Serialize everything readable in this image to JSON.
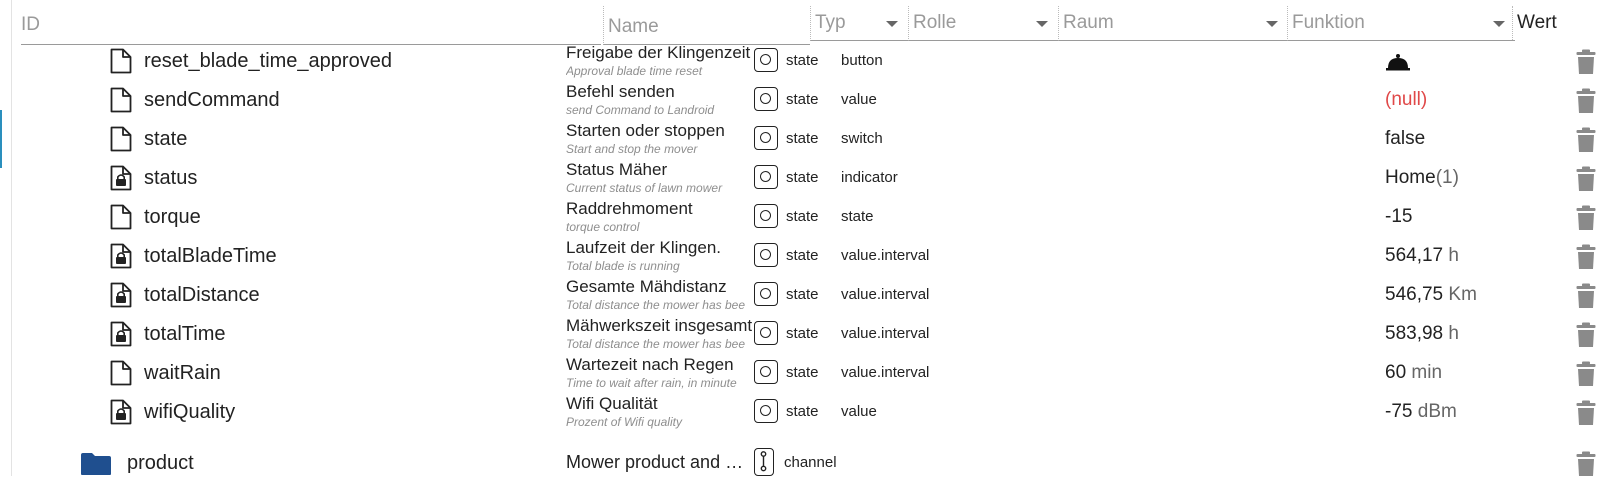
{
  "header": {
    "id": "ID",
    "name": "Name",
    "typ": "Typ",
    "rolle": "Rolle",
    "raum": "Raum",
    "funktion": "Funktion",
    "wert": "Wert"
  },
  "rows": [
    {
      "id": "reset_blade_time_approved",
      "icon": "file-icon",
      "name": "Freigabe der Klingenzeit",
      "desc": "Approval blade time reset",
      "type": "state",
      "role": "button",
      "value": "",
      "unit": "",
      "value_icon": "bell-icon"
    },
    {
      "id": "sendCommand",
      "icon": "file-icon",
      "name": "Befehl senden",
      "desc": "send Command to Landroid",
      "type": "state",
      "role": "value",
      "value": "(null)",
      "unit": ""
    },
    {
      "id": "state",
      "icon": "file-icon",
      "name": "Starten oder stoppen",
      "desc": "Start and stop the mover",
      "type": "state",
      "role": "switch",
      "value": "false",
      "unit": ""
    },
    {
      "id": "status",
      "icon": "locked-file-icon",
      "name": "Status Mäher",
      "desc": "Current status of lawn mower",
      "type": "state",
      "role": "indicator",
      "value": "Home",
      "unit": "(1)"
    },
    {
      "id": "torque",
      "icon": "file-icon",
      "name": "Raddrehmoment",
      "desc": "torque control",
      "type": "state",
      "role": "state",
      "value": "-15",
      "unit": ""
    },
    {
      "id": "totalBladeTime",
      "icon": "locked-file-icon",
      "name": "Laufzeit der Klingen.",
      "desc": "Total blade is running",
      "type": "state",
      "role": "value.interval",
      "value": "564,17",
      "unit": "h"
    },
    {
      "id": "totalDistance",
      "icon": "locked-file-icon",
      "name": "Gesamte Mähdistanz",
      "desc": "Total distance the mower has bee",
      "type": "state",
      "role": "value.interval",
      "value": "546,75",
      "unit": "Km"
    },
    {
      "id": "totalTime",
      "icon": "locked-file-icon",
      "name": "Mähwerkszeit insgesamt",
      "desc": "Total distance the mower has bee",
      "type": "state",
      "role": "value.interval",
      "value": "583,98",
      "unit": "h"
    },
    {
      "id": "waitRain",
      "icon": "file-icon",
      "name": "Wartezeit nach Regen",
      "desc": "Time to wait after rain, in minute",
      "type": "state",
      "role": "value.interval",
      "value": "60",
      "unit": "min"
    },
    {
      "id": "wifiQuality",
      "icon": "locked-file-icon",
      "name": "Wifi Qualität",
      "desc": "Prozent of Wifi quality",
      "type": "state",
      "role": "value",
      "value": "-75",
      "unit": "dBm"
    }
  ],
  "product": {
    "id": "product",
    "icon": "folder-icon",
    "name": "Mower product and b...",
    "type": "channel"
  },
  "colors": {
    "null_value": "#e04848",
    "folder": "#1f4f8f",
    "accent": "#2a8fbd"
  }
}
